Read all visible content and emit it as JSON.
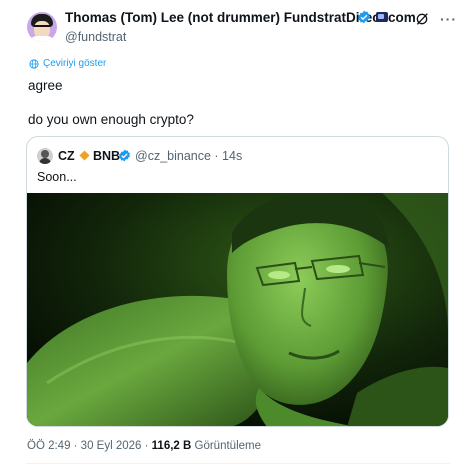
{
  "author": {
    "display_name": "Thomas (Tom) Lee (not drummer) FundstratDirect.com",
    "handle": "@fundstrat"
  },
  "translate_label": "Çeviriyi göster",
  "tweet_lines": [
    "agree",
    "do you own enough crypto?"
  ],
  "quoted_tweet": {
    "name": "CZ",
    "name_suffix": "BNB",
    "handle_time": "@cz_binance · 14s",
    "text": "Soon..."
  },
  "meta": {
    "timestamp": "ÖÖ 2:49 · 30 Eyl 2026 ·",
    "views_count": "116,2 B",
    "views_label": "Görüntüleme"
  },
  "colors": {
    "accent": "#1d9bf0",
    "text_primary": "#0f1419",
    "text_secondary": "#536471",
    "border": "#cfd9de",
    "night_vision_green": "#5c9a34"
  },
  "icons": [
    "verified-badge-icon",
    "flag-icon",
    "grok-icon",
    "more-icon",
    "globe-icon",
    "diamond-icon"
  ]
}
